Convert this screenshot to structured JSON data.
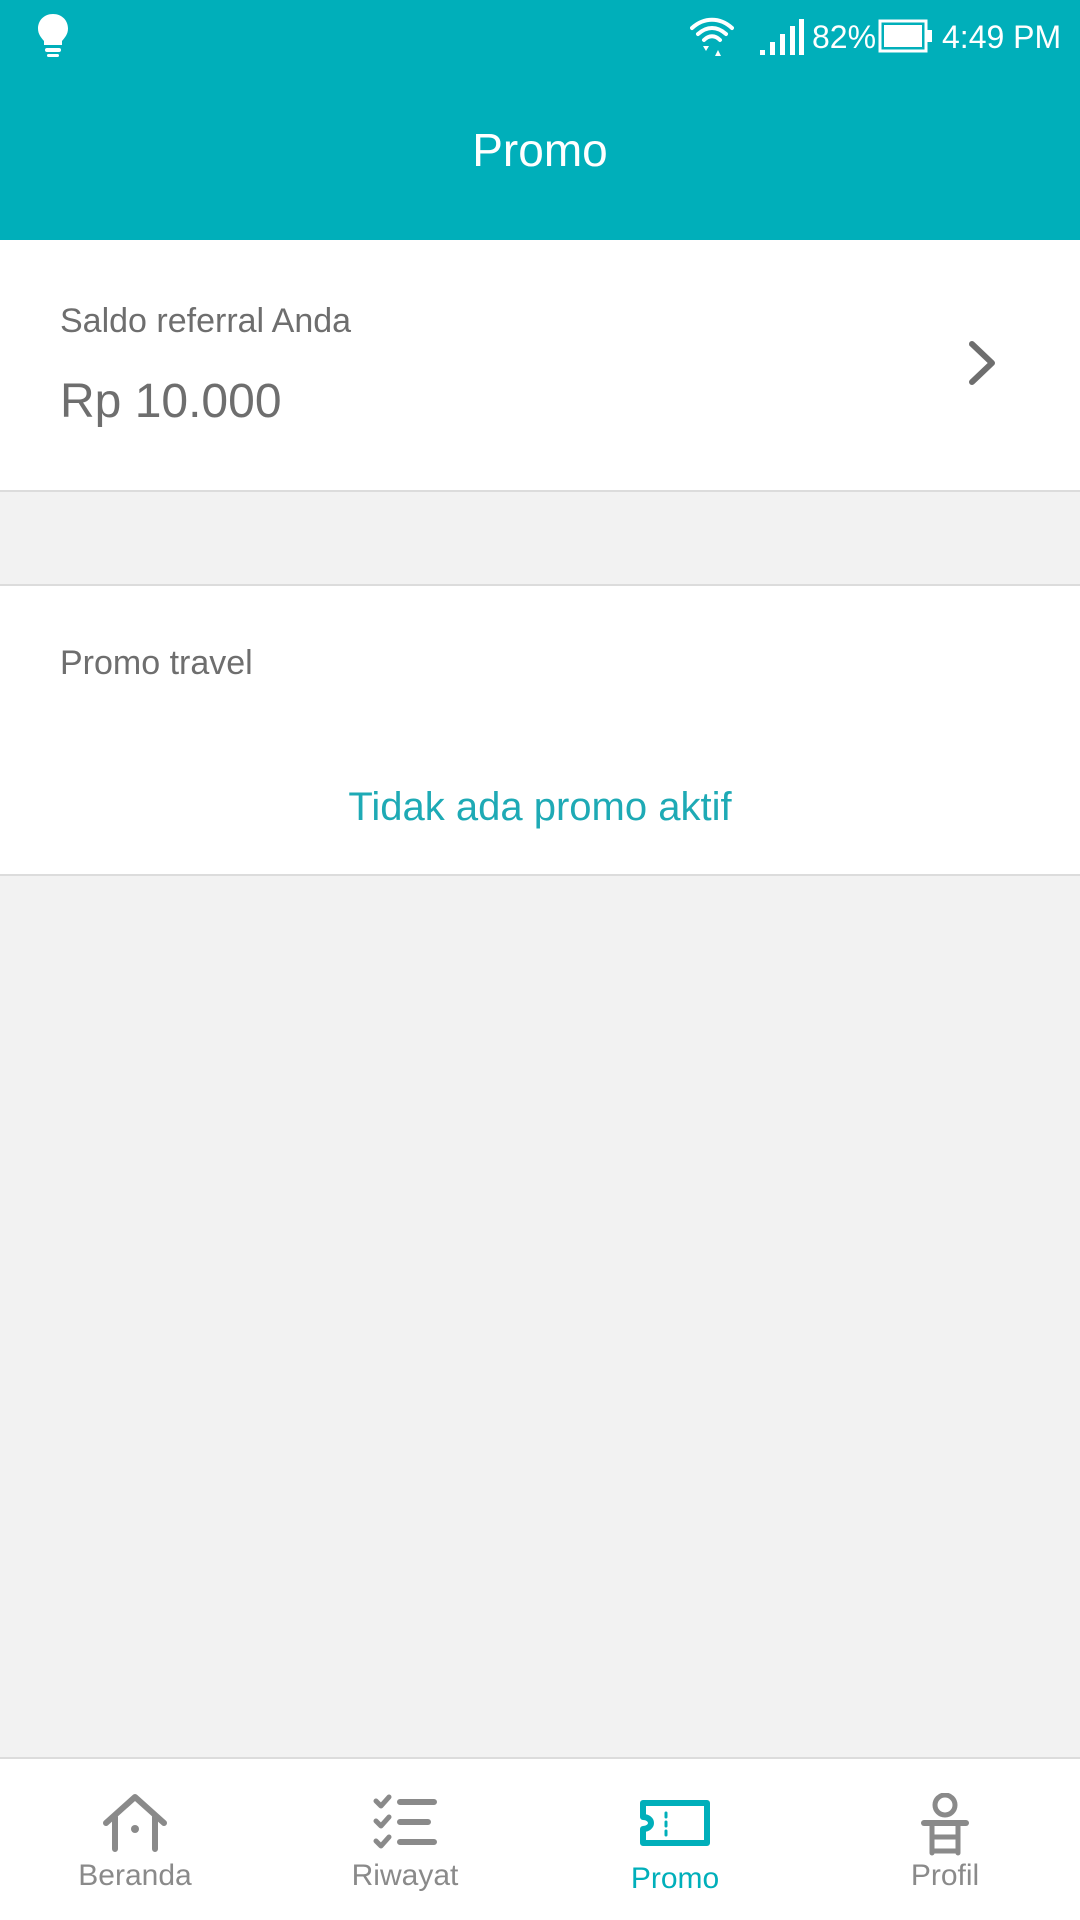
{
  "status_bar": {
    "battery_percent": "82%",
    "time": "4:49 PM",
    "icons": [
      "lightbulb-icon",
      "wifi-icon",
      "signal-icon",
      "battery-icon"
    ]
  },
  "header": {
    "title": "Promo",
    "color": "#00afba"
  },
  "referral": {
    "label": "Saldo referral Anda",
    "amount": "Rp 10.000",
    "icon": "chevron-right-icon"
  },
  "promo_travel": {
    "label": "Promo travel",
    "empty_text": "Tidak ada promo aktif"
  },
  "bottom_nav": {
    "items": [
      {
        "label": "Beranda",
        "icon": "home-icon",
        "active": false
      },
      {
        "label": "Riwayat",
        "icon": "checklist-icon",
        "active": false
      },
      {
        "label": "Promo",
        "icon": "ticket-icon",
        "active": true
      },
      {
        "label": "Profil",
        "icon": "profile-icon",
        "active": false
      }
    ],
    "active_color": "#00afba",
    "inactive_color": "#8a8a8a"
  }
}
